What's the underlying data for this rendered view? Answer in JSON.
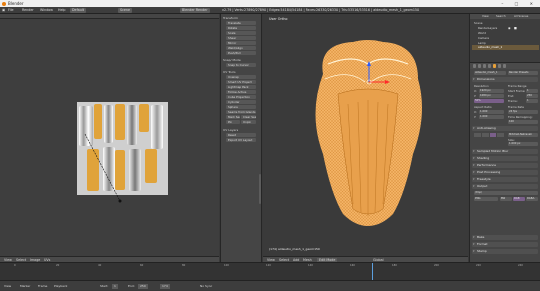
{
  "window": {
    "title": "Blender",
    "controls": "–  □  ✕"
  },
  "infobar": {
    "menus": [
      "File",
      "Render",
      "Window",
      "Help"
    ],
    "layout": "Default",
    "scene": "Scene",
    "engine": "Blender Render",
    "stats": "v2.79 | Verts:27890/27890 | Edges:54184/54184 | Faces:26330/26330 | Tris:53516/53516 | aldeudio_mesh_1_geom150"
  },
  "uv_editor": {
    "footer": [
      "View",
      "Select",
      "Image",
      "UVs"
    ]
  },
  "tool_shelf": {
    "sections": [
      {
        "title": "Transform",
        "buttons": [
          "Translate",
          "Rotate",
          "Scale",
          "Shear",
          "Mirror",
          "Weld/Align",
          "Push/Pull"
        ]
      },
      {
        "title": "Snap/ Mode",
        "buttons": [
          "Snap to Cursor"
        ]
      },
      {
        "title": "UV Tools",
        "buttons": [
          "Unwrap",
          "Smart UV Project",
          "Lightmap Pack",
          "Follow Active",
          "Cube Projection",
          "Cylinder",
          "Sphere",
          "Seams from Islands",
          "Mark Seam",
          "Clear Seam",
          "Pin",
          "Unpin"
        ]
      },
      {
        "title": "UV Layers",
        "buttons": [
          "Reset",
          "Export UV Layout"
        ]
      }
    ]
  },
  "viewport": {
    "label": "User Ortho",
    "info": "(174) aldeudio_mesh_1_geom150",
    "footer": [
      "View",
      "Select",
      "Add",
      "Mesh",
      "Edit Mode",
      "Global"
    ]
  },
  "outliner": {
    "tabs": [
      "View",
      "Search",
      "All Scenes"
    ],
    "items": [
      {
        "name": "Scene",
        "selected": false
      },
      {
        "name": "RenderLayers",
        "selected": false
      },
      {
        "name": "World",
        "selected": false
      },
      {
        "name": "Camera",
        "selected": false
      },
      {
        "name": "Lamp",
        "selected": false
      },
      {
        "name": "aldeudio_mesh_1",
        "selected": true
      }
    ]
  },
  "properties": {
    "object_name": "aldeudio_mesh_1",
    "headers": [
      "Dimensions",
      "Resolution",
      "Frame Range",
      "Aspect Ratio",
      "Frame Rate",
      "Anti-Aliasing",
      "Sampled Motion Blur",
      "Shading",
      "Performance",
      "Post Processing",
      "Freestyle",
      "Output",
      "Bake",
      "Format",
      "Stamp"
    ],
    "fields": [
      {
        "label": "Render Presets",
        "value": ""
      },
      {
        "label": "X:",
        "value": "1920 px"
      },
      {
        "label": "Y:",
        "value": "1080 px"
      },
      {
        "label": "",
        "value": "50%"
      },
      {
        "label": "Start Frame:",
        "value": "1"
      },
      {
        "label": "End:",
        "value": "250"
      },
      {
        "label": "Frame:",
        "value": "1"
      },
      {
        "label": "X:",
        "value": "1.000"
      },
      {
        "label": "Y:",
        "value": "1.000"
      },
      {
        "label": "",
        "value": "24 fps"
      },
      {
        "label": "Time Remapping:",
        "value": "100"
      },
      {
        "label": "",
        "value": "Mitchell-Netravali"
      },
      {
        "label": "Size:",
        "value": "1.000 px"
      }
    ],
    "output_path": "/tmp/",
    "file_format": "PNG",
    "color_modes": [
      "BW",
      "RGB",
      "RGBA"
    ]
  },
  "timeline": {
    "menus": [
      "View",
      "Marker",
      "Frame",
      "Playback"
    ],
    "start_label": "Start:",
    "start": "1",
    "end_label": "End:",
    "end": "250",
    "current": "174",
    "sync": "No Sync",
    "ticks": [
      "0",
      "20",
      "40",
      "60",
      "80",
      "100",
      "120",
      "140",
      "160",
      "180",
      "200",
      "220",
      "240"
    ]
  },
  "colors": {
    "accent": "#e8a13a",
    "selection": "#f4a64a",
    "background": "#393939"
  }
}
